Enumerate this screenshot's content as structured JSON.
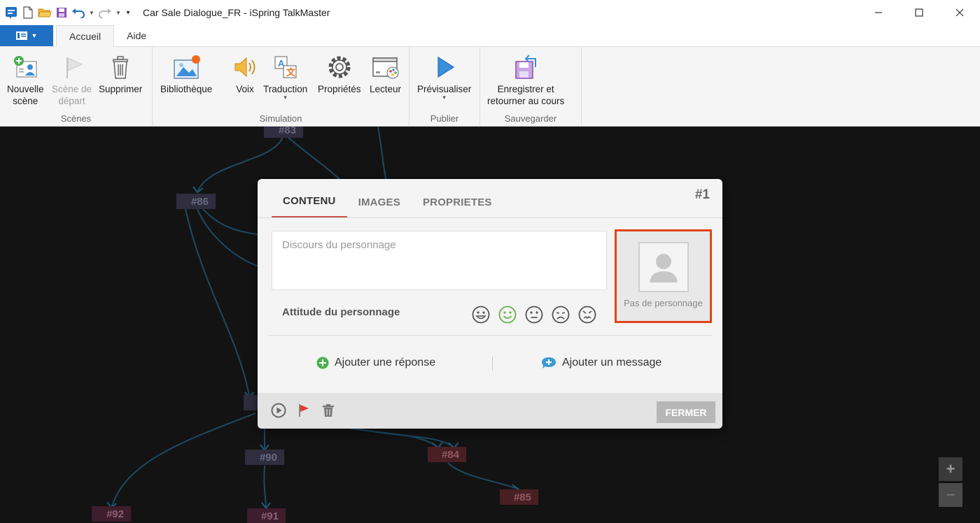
{
  "window": {
    "title": "Car Sale Dialogue_FR - iSpring TalkMaster",
    "icons": [
      "app-icon",
      "new-file-icon",
      "open-folder-icon",
      "save-icon",
      "undo-icon",
      "redo-icon",
      "customize-icon"
    ],
    "controls": [
      "minimize-icon",
      "maximize-icon",
      "close-icon"
    ]
  },
  "ribbon_tabs": [
    {
      "label": "Accueil",
      "active": true
    },
    {
      "label": "Aide",
      "active": false
    }
  ],
  "ribbon": {
    "groups": {
      "scenes": "Scènes",
      "simulation": "Simulation",
      "publish": "Publier",
      "save": "Sauvegarder"
    },
    "buttons": {
      "new_scene_1": "Nouvelle",
      "new_scene_2": "scène",
      "start_scene_1": "Scène de",
      "start_scene_2": "départ",
      "delete": "Supprimer",
      "library": "Bibliothèque",
      "voice": "Voix",
      "translation": "Traduction",
      "properties": "Propriétés",
      "player": "Lecteur",
      "preview": "Prévisualiser",
      "save_return_1": "Enregistrer et",
      "save_return_2": "retourner au cours"
    }
  },
  "nodes": [
    {
      "label": "#83"
    },
    {
      "label": "#86"
    },
    {
      "label": "#90"
    },
    {
      "label": "#84"
    },
    {
      "label": "#85"
    },
    {
      "label": "#92"
    },
    {
      "label": "#91"
    }
  ],
  "dialog": {
    "tabs": [
      "CONTENU",
      "IMAGES",
      "PROPRIETES"
    ],
    "active_tab": "CONTENU",
    "scene_number": "#1",
    "speech_placeholder": "Discours du personnage",
    "attitude_label": "Attitude du personnage",
    "attitudes": [
      "happy",
      "smile",
      "neutral",
      "sad",
      "angry"
    ],
    "selected_attitude": "smile",
    "character_caption": "Pas de personnage",
    "add_response": "Ajouter une réponse",
    "add_message": "Ajouter un message",
    "close_label": "FERMER"
  },
  "zoom": {
    "in": "+",
    "out": "−"
  },
  "colors": {
    "accent_blue": "#1f6fc5",
    "active_tab_underline": "#c9524e",
    "highlight_border": "#e0441c",
    "canvas_bg": "#131313",
    "selected_emotion": "#6ab04c"
  }
}
